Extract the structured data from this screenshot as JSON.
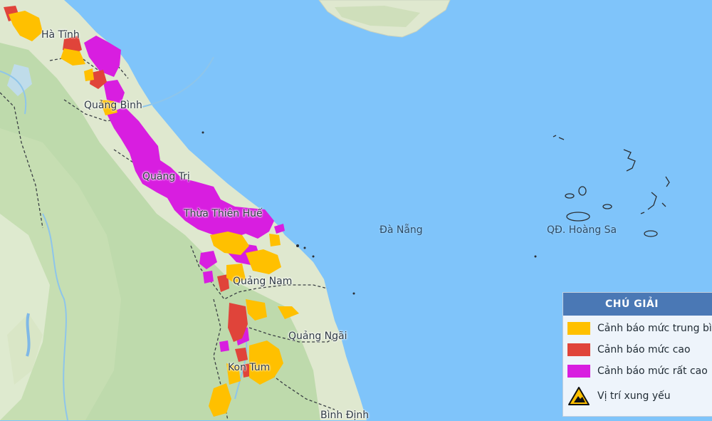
{
  "map": {
    "colors": {
      "sea": "#7fc4fa",
      "land": "#dfe8cf",
      "forest": "#b9d7a6",
      "moderate": "#ffc000",
      "high": "#e0443a",
      "very_high": "#d81ee0"
    },
    "places": {
      "ha_tinh": "Hà Tĩnh",
      "quang_binh": "Quảng Bình",
      "quang_tri": "Quảng Trị",
      "thua_thien_hue": "Thừa Thiên Huế",
      "da_nang": "Đà Nẵng",
      "quang_nam": "Quảng Nam",
      "quang_ngai": "Quảng Ngãi",
      "kon_tum": "Kon Tum",
      "binh_dinh": "Bình Định",
      "hoang_sa": "QĐ. Hoàng Sa"
    }
  },
  "legend": {
    "title": "CHÚ GIẢI",
    "items": [
      {
        "label": "Cảnh báo mức trung bình",
        "color": "#ffc000"
      },
      {
        "label": "Cảnh báo mức cao",
        "color": "#e0443a"
      },
      {
        "label": "Cảnh báo mức rất cao",
        "color": "#d81ee0"
      },
      {
        "label": "Vị trí xung yếu",
        "icon": "warning-triangle-icon"
      }
    ]
  }
}
